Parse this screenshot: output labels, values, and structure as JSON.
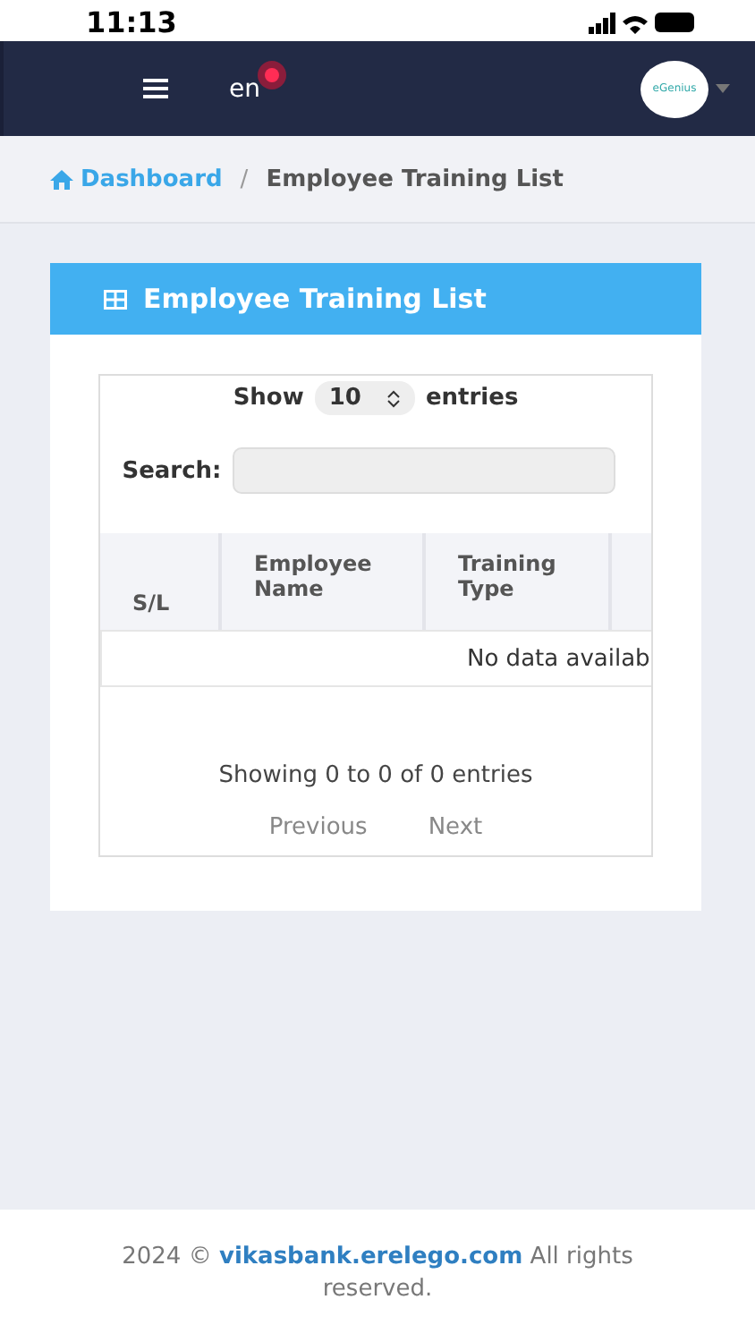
{
  "status_bar": {
    "time": "11:13"
  },
  "navbar": {
    "language": "en",
    "notification": true,
    "logo_text": "eGenius"
  },
  "breadcrumb_separator": "/",
  "breadcrumb": [
    {
      "label": "Dashboard",
      "kind": "link"
    },
    {
      "label": "Employee Training List",
      "kind": "current"
    }
  ],
  "card": {
    "title": "Employee Training List"
  },
  "table_controls": {
    "show_label": "Show",
    "page_size": "10",
    "entries_label": "entries",
    "search_label": "Search:"
  },
  "table": {
    "columns": [
      "S/L",
      "Employee Name",
      "Training Type"
    ],
    "empty_message": "No data availab"
  },
  "table_info": "Showing 0 to 0 of 0 entries",
  "pagination": [
    {
      "label": "Previous",
      "disabled": true
    },
    {
      "label": "Next",
      "disabled": true
    }
  ],
  "footer": {
    "before": "2024 ©",
    "link": "vikasbank.erelego.com",
    "after": "All rights reserved."
  }
}
